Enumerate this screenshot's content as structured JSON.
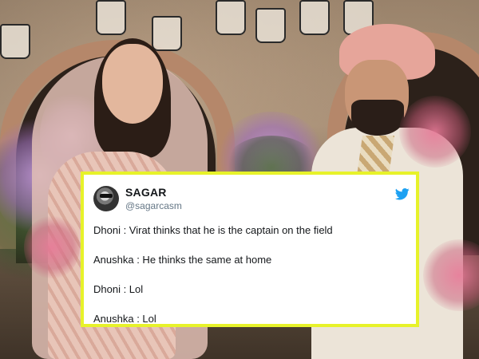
{
  "tweet": {
    "display_name": "SAGAR",
    "handle": "@sagarcasm",
    "brand_icon": "twitter-bird-icon",
    "lines": [
      "Dhoni : Virat thinks that he is the captain on the field",
      "Anushka : He thinks the same at home",
      "Dhoni : Lol",
      "Anushka : Lol"
    ]
  },
  "colors": {
    "highlight_border": "#e7f22a",
    "twitter_blue": "#1da1f2",
    "name_text": "#14171a",
    "handle_text": "#657786"
  }
}
